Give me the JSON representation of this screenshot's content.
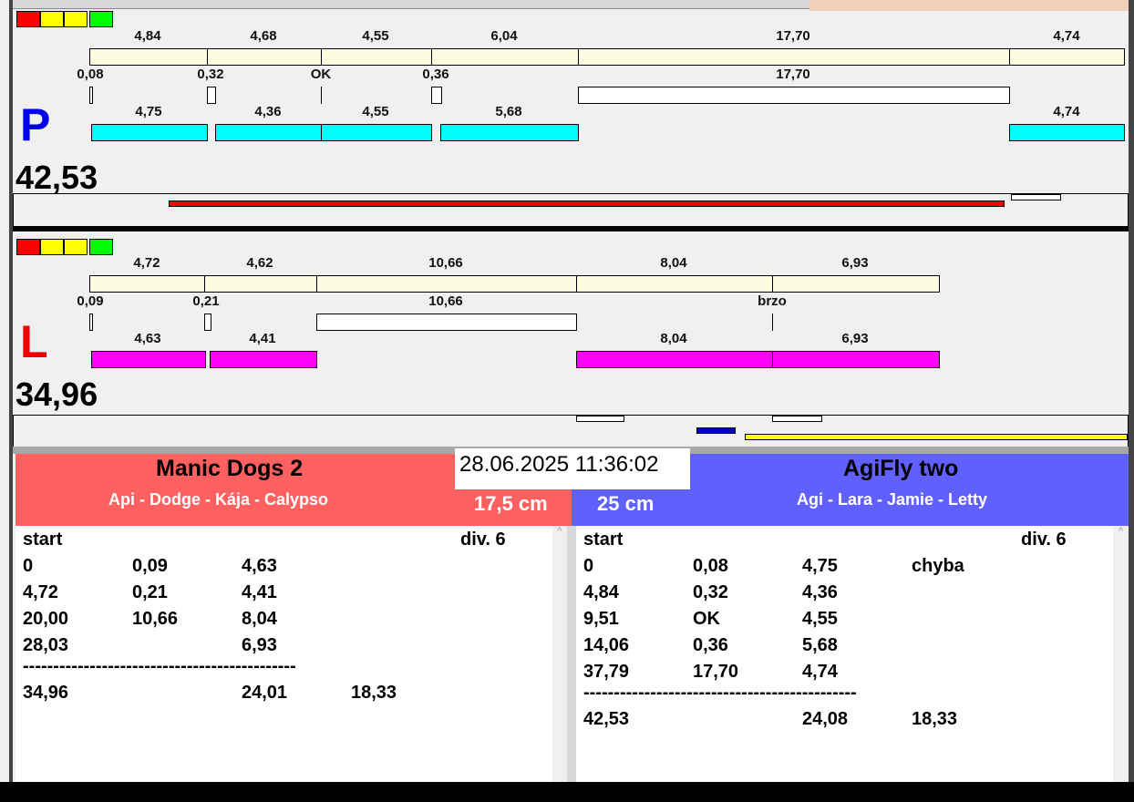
{
  "lane_p": {
    "letter": "P",
    "total": "42,53",
    "row1": [
      "4,84",
      "4,68",
      "4,55",
      "6,04",
      "17,70",
      "4,74"
    ],
    "row2": [
      "0,08",
      "0,32",
      "OK",
      "0,36",
      "17,70"
    ],
    "row3": [
      "4,75",
      "4,36",
      "4,55",
      "5,68",
      "4,74"
    ]
  },
  "lane_l": {
    "letter": "L",
    "total": "34,96",
    "row1": [
      "4,72",
      "4,62",
      "10,66",
      "8,04",
      "6,93"
    ],
    "row2": [
      "0,09",
      "0,21",
      "10,66",
      "brzo"
    ],
    "row3": [
      "4,63",
      "4,41",
      "8,04",
      "6,93"
    ]
  },
  "datetime": "28.06.2025 11:36:02",
  "left_team": {
    "name": "Manic Dogs 2",
    "dogs": "Api - Dodge - Kája - Calypso",
    "height": "17,5 cm",
    "color": "#ff6060"
  },
  "right_team": {
    "name": "AgiFly two",
    "dogs": "Agi - Lara - Jamie - Letty",
    "height": "25 cm",
    "color": "#6060ff"
  },
  "left_list": {
    "header": "start",
    "div": "div.  6",
    "rows": [
      [
        "0",
        "0,09",
        "4,63",
        ""
      ],
      [
        "4,72",
        "0,21",
        "4,41",
        ""
      ],
      [
        "20,00",
        "10,66",
        "8,04",
        ""
      ],
      [
        "28,03",
        "",
        "6,93",
        ""
      ]
    ],
    "separator": "---------------------------------------------",
    "totals": [
      "34,96",
      "",
      "24,01",
      "18,33"
    ]
  },
  "right_list": {
    "header": "start",
    "div": "div.  6",
    "rows": [
      [
        "0",
        "0,08",
        "4,75",
        "chyba"
      ],
      [
        "4,84",
        "0,32",
        "4,36",
        ""
      ],
      [
        "9,51",
        "OK",
        "4,55",
        ""
      ],
      [
        "14,06",
        "0,36",
        "5,68",
        ""
      ],
      [
        "37,79",
        "17,70",
        "4,74",
        ""
      ]
    ],
    "separator": "---------------------------------------------",
    "totals": [
      "42,53",
      "",
      "24,08",
      "18,33"
    ]
  }
}
